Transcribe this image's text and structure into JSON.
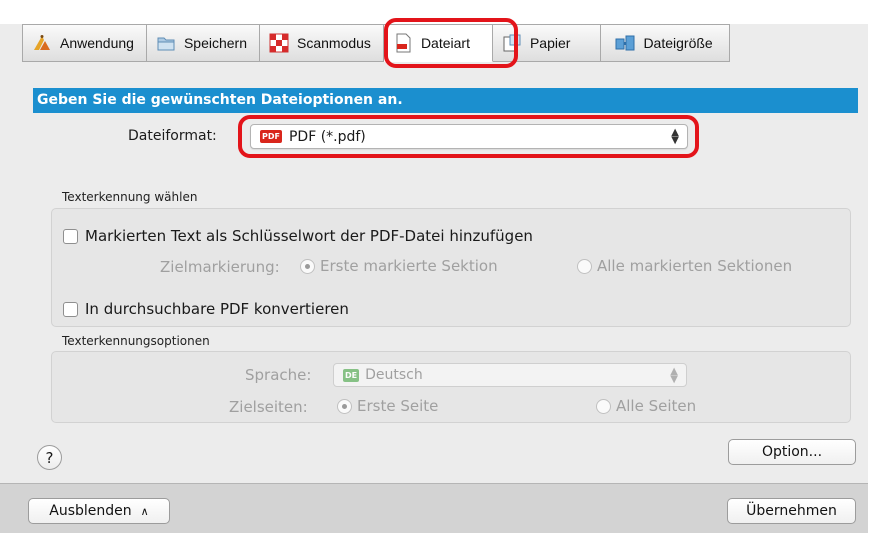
{
  "tabs": [
    {
      "label": "Anwendung",
      "icon": "application-icon"
    },
    {
      "label": "Speichern",
      "icon": "folder-icon"
    },
    {
      "label": "Scanmodus",
      "icon": "scan-mode-icon"
    },
    {
      "label": "Dateiart",
      "icon": "file-type-icon",
      "active": true
    },
    {
      "label": "Papier",
      "icon": "paper-icon"
    },
    {
      "label": "Dateigröße",
      "icon": "file-size-icon"
    }
  ],
  "banner": "Geben Sie die gewünschten Dateioptionen an.",
  "file_format": {
    "label": "Dateiformat:",
    "badge": "PDF",
    "value": "PDF (*.pdf)"
  },
  "text_recognition": {
    "title": "Texterkennung wählen",
    "keyword_checkbox": "Markierten Text als Schlüsselwort der PDF-Datei hinzufügen",
    "target_label": "Zielmarkierung:",
    "target_first": "Erste markierte Sektion",
    "target_all": "Alle markierten Sektionen",
    "searchable_checkbox": "In durchsuchbare PDF konvertieren"
  },
  "ocr_options": {
    "title": "Texterkennungsoptionen",
    "language_label": "Sprache:",
    "language_badge": "DE",
    "language_value": "Deutsch",
    "pages_label": "Zielseiten:",
    "pages_first": "Erste Seite",
    "pages_all": "Alle Seiten"
  },
  "buttons": {
    "option": "Option...",
    "help": "?",
    "hide": "Ausblenden",
    "apply": "Übernehmen"
  },
  "colors": {
    "banner": "#1b8fcf",
    "highlight": "#e3141a",
    "pdf_badge": "#d9261c"
  }
}
